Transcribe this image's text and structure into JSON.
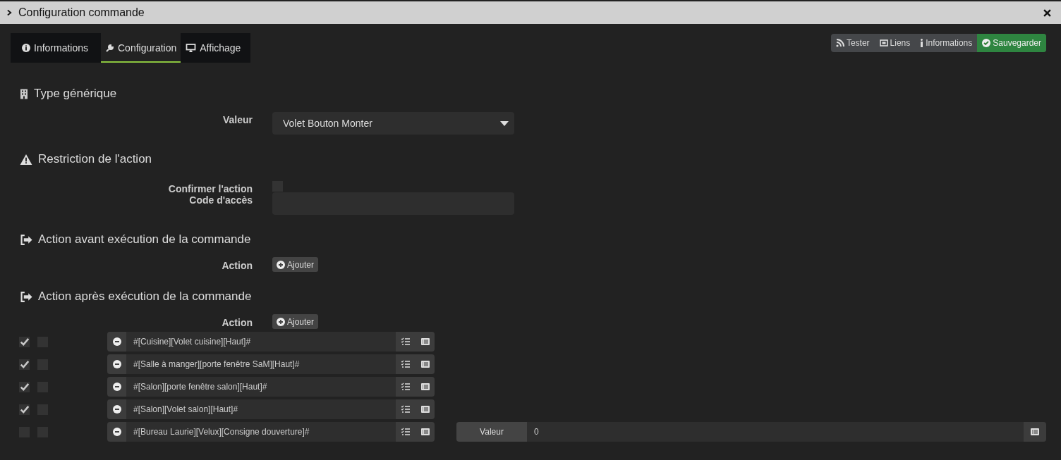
{
  "window": {
    "title": "Configuration commande"
  },
  "tabs": [
    {
      "label": "Informations",
      "kind": "info",
      "selected": false
    },
    {
      "label": "Configuration",
      "kind": "config",
      "selected": true
    },
    {
      "label": "Affichage",
      "kind": "display",
      "selected": false
    }
  ],
  "toolbar": [
    {
      "label": "Tester",
      "kind": "test"
    },
    {
      "label": "Liens",
      "kind": "links"
    },
    {
      "label": "Informations",
      "kind": "info"
    },
    {
      "label": "Sauvegarder",
      "kind": "save"
    }
  ],
  "generic_type": {
    "heading": "Type générique",
    "label": "Valeur",
    "value": "Volet Bouton Monter"
  },
  "restriction": {
    "heading": "Restriction de l'action",
    "confirm_label": "Confirmer l'action",
    "confirm_checked": false,
    "code_label": "Code d'accès"
  },
  "before": {
    "heading": "Action avant exécution de la commande",
    "label": "Action",
    "add_button": "Ajouter"
  },
  "after": {
    "heading": "Action après exécution de la commande",
    "label": "Action",
    "add_button": "Ajouter",
    "actions": [
      {
        "enabled": true,
        "background": false,
        "command": "#[Cuisine][Volet cuisine][Haut]#"
      },
      {
        "enabled": true,
        "background": false,
        "command": "#[Salle à manger][porte fenêtre SaM][Haut]#"
      },
      {
        "enabled": true,
        "background": false,
        "command": "#[Salon][porte fenêtre salon][Haut]#"
      },
      {
        "enabled": true,
        "background": false,
        "command": "#[Salon][Volet salon][Haut]#"
      },
      {
        "enabled": false,
        "background": false,
        "command": "#[Bureau Laurie][Velux][Consigne douverture]#",
        "option": {
          "label": "Valeur",
          "value": "0"
        }
      }
    ]
  }
}
